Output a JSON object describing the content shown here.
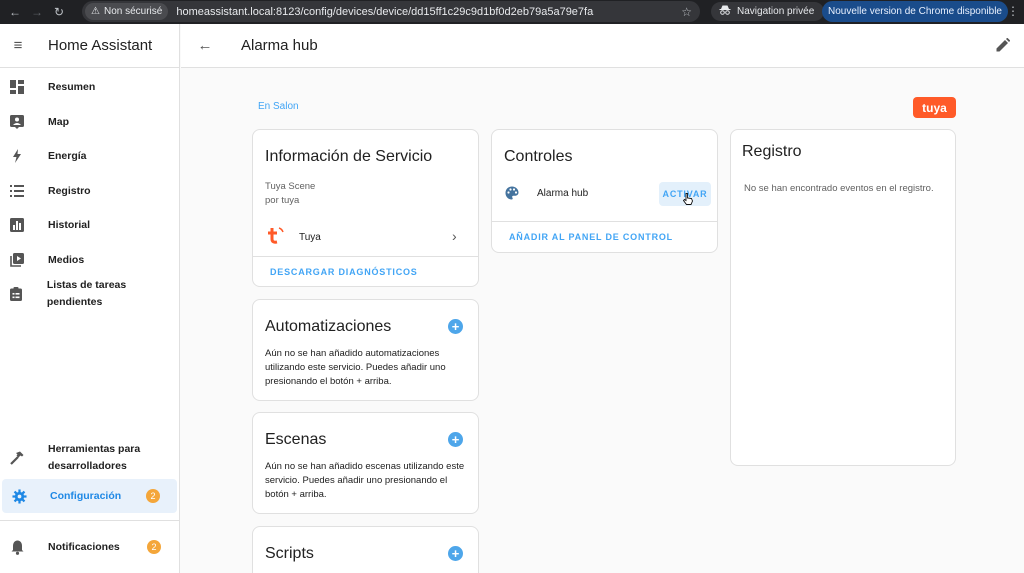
{
  "browser": {
    "security_label": "Non sécurisé",
    "url": "homeassistant.local:8123/config/devices/device/dd15ff1c29c9d1bf0d2eb79a5a79e7fa",
    "incognito_label": "Navigation privée",
    "update_label": "Nouvelle version de Chrome disponible"
  },
  "sidebar": {
    "title": "Home Assistant",
    "items": [
      {
        "label": "Resumen"
      },
      {
        "label": "Map"
      },
      {
        "label": "Energía"
      },
      {
        "label": "Registro"
      },
      {
        "label": "Historial"
      },
      {
        "label": "Medios"
      },
      {
        "label": "Listas de tareas pendientes"
      }
    ],
    "dev_tools": "Herramientas para desarrolladores",
    "config": {
      "label": "Configuración",
      "badge": "2"
    },
    "notifications": {
      "label": "Notificaciones",
      "badge": "2"
    }
  },
  "header": {
    "title": "Alarma hub"
  },
  "area_link": "En Salon",
  "brand_logo": "tuya",
  "service_info": {
    "title": "Información de Servicio",
    "model": "Tuya Scene",
    "manufacturer": "por tuya",
    "integration": "Tuya",
    "action": "DESCARGAR DIAGNÓSTICOS"
  },
  "automations": {
    "title": "Automatizaciones",
    "text": "Aún no se han añadido automatizaciones utilizando este servicio. Puedes añadir uno presionando el botón + arriba."
  },
  "scenes": {
    "title": "Escenas",
    "text": "Aún no se han añadido escenas utilizando este servicio. Puedes añadir uno presionando el botón + arriba."
  },
  "scripts": {
    "title": "Scripts"
  },
  "controls": {
    "title": "Controles",
    "entity": "Alarma hub",
    "activate": "ACTIVAR",
    "add_dashboard": "AÑADIR AL PANEL DE CONTROL"
  },
  "logbook": {
    "title": "Registro",
    "empty": "No se han encontrado eventos en el registro."
  },
  "colors": {
    "accent": "#1e88e5",
    "badge": "#f4a63a",
    "tuya": "#ff5a28"
  }
}
